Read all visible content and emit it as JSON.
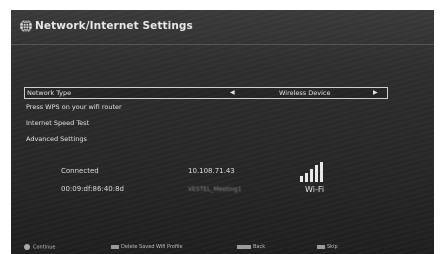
{
  "header": {
    "title": "Network/Internet Settings"
  },
  "menu": {
    "network_type_label": "Network Type",
    "network_type_value": "Wireless Device",
    "wps_label": "Press WPS on your wifi router",
    "speed_test_label": "Internet Speed Test",
    "advanced_label": "Advanced Settings"
  },
  "status": {
    "connection": "Connected",
    "ip_address": "10.108.71.43",
    "mac_address": "00:09:df:86:40:8d",
    "ssid": "VESTEL_Meeting1",
    "signal_label": "Wi-Fi"
  },
  "footer": {
    "continue_label": "Continue",
    "delete_label": "Delete Saved Wifi Profile",
    "back_label": "Back",
    "skip_label": "Skip"
  }
}
